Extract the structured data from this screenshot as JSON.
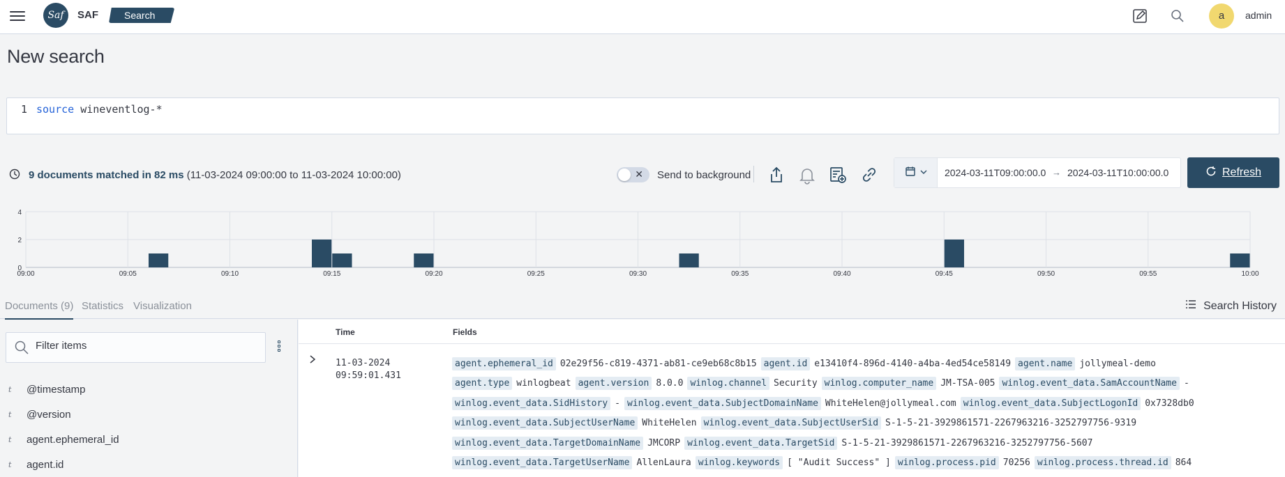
{
  "header": {
    "app_name": "SAF",
    "logo_text": "Saf",
    "breadcrumb": "Search",
    "avatar_letter": "a",
    "username": "admin",
    "icons": [
      "menu-icon",
      "edit-icon",
      "search-icon"
    ]
  },
  "page_title": "New search",
  "query": {
    "line_number": "1",
    "keyword": "source",
    "argument": " wineventlog-*"
  },
  "results": {
    "summary": "9 documents matched in 82 ms",
    "range_text": "(11-03-2024 09:00:00 to 11-03-2024 10:00:00)",
    "send_to_background": "Send to background",
    "date_from": "2024-03-11T09:00:00.0",
    "date_arrow": "→",
    "date_to": "2024-03-11T10:00:00.0",
    "refresh_label": "Refresh",
    "tool_icons": [
      "share-icon",
      "bell-icon",
      "add-report-icon",
      "link-icon"
    ]
  },
  "chart_data": {
    "type": "bar",
    "x_ticks": [
      "09:00",
      "09:05",
      "09:10",
      "09:15",
      "09:20",
      "09:25",
      "09:30",
      "09:35",
      "09:40",
      "09:45",
      "09:50",
      "09:55",
      "10:00"
    ],
    "y_ticks": [
      "0",
      "2",
      "4"
    ],
    "ylim": [
      0,
      4
    ],
    "xlim_minutes": [
      0,
      60
    ],
    "bars": [
      {
        "minute": 6,
        "value": 1
      },
      {
        "minute": 14,
        "value": 2
      },
      {
        "minute": 15,
        "value": 1
      },
      {
        "minute": 19,
        "value": 1
      },
      {
        "minute": 32,
        "value": 1
      },
      {
        "minute": 45,
        "value": 2
      },
      {
        "minute": 59,
        "value": 1
      }
    ],
    "color": "#2a4b64",
    "grid": true
  },
  "tabs": [
    {
      "label": "Documents (9)",
      "active": true
    },
    {
      "label": "Statistics",
      "active": false
    },
    {
      "label": "Visualization",
      "active": false
    }
  ],
  "search_history": "Search History",
  "filter_placeholder": "Filter items",
  "field_list": [
    {
      "type": "t",
      "name": "@timestamp"
    },
    {
      "type": "t",
      "name": "@version"
    },
    {
      "type": "t",
      "name": "agent.ephemeral_id"
    },
    {
      "type": "t",
      "name": "agent.id"
    }
  ],
  "table": {
    "col_time": "Time",
    "col_fields": "Fields",
    "row": {
      "date": "11-03-2024",
      "time": "09:59:01.431",
      "field_lines": [
        [
          [
            "agent.ephemeral_id",
            "02e29f56-c819-4371-ab81-ce9eb68c8b15"
          ],
          [
            "agent.id",
            "e13410f4-896d-4140-a4ba-4ed54ce58149"
          ],
          [
            "agent.name",
            "jollymeal-demo"
          ]
        ],
        [
          [
            "agent.type",
            "winlogbeat"
          ],
          [
            "agent.version",
            "8.0.0"
          ],
          [
            "winlog.channel",
            "Security"
          ],
          [
            "winlog.computer_name",
            "JM-TSA-005"
          ],
          [
            "winlog.event_data.SamAccountName",
            "-"
          ]
        ],
        [
          [
            "winlog.event_data.SidHistory",
            "-"
          ],
          [
            "winlog.event_data.SubjectDomainName",
            "WhiteHelen@jollymeal.com"
          ],
          [
            "winlog.event_data.SubjectLogonId",
            "0x7328db0"
          ]
        ],
        [
          [
            "winlog.event_data.SubjectUserName",
            "WhiteHelen"
          ],
          [
            "winlog.event_data.SubjectUserSid",
            "S-1-5-21-3929861571-2267963216-3252797756-9319"
          ]
        ],
        [
          [
            "winlog.event_data.TargetDomainName",
            "JMCORP"
          ],
          [
            "winlog.event_data.TargetSid",
            "S-1-5-21-3929861571-2267963216-3252797756-5607"
          ]
        ],
        [
          [
            "winlog.event_data.TargetUserName",
            "AllenLaura"
          ],
          [
            "winlog.keywords",
            "[ \"Audit Success\" ]"
          ],
          [
            "winlog.process.pid",
            "70256"
          ],
          [
            "winlog.process.thread.id",
            "864"
          ]
        ]
      ]
    }
  }
}
